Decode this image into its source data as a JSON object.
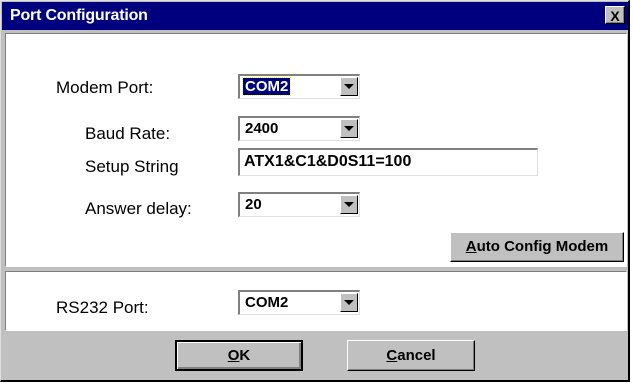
{
  "window": {
    "title": "Port Configuration",
    "close_label": "X"
  },
  "modem": {
    "port_label": "Modem Port:",
    "port_value": "COM2",
    "baud_label": "Baud Rate:",
    "baud_value": "2400",
    "setup_label": "Setup String",
    "setup_value": "ATX1&C1&D0S11=100",
    "delay_label": "Answer delay:",
    "delay_value": "20",
    "auto_config_accel": "A",
    "auto_config_rest": "uto Config Modem"
  },
  "rs232": {
    "port_label": "RS232 Port:",
    "port_value": "COM2"
  },
  "buttons": {
    "ok_accel": "O",
    "ok_rest": "K",
    "cancel_accel": "C",
    "cancel_rest": "ancel"
  },
  "icons": {
    "dropdown": "chevron-down-icon",
    "close": "close-icon"
  },
  "colors": {
    "titlebar": "#00007f",
    "face": "#c0c0c0",
    "selection": "#00007f"
  }
}
